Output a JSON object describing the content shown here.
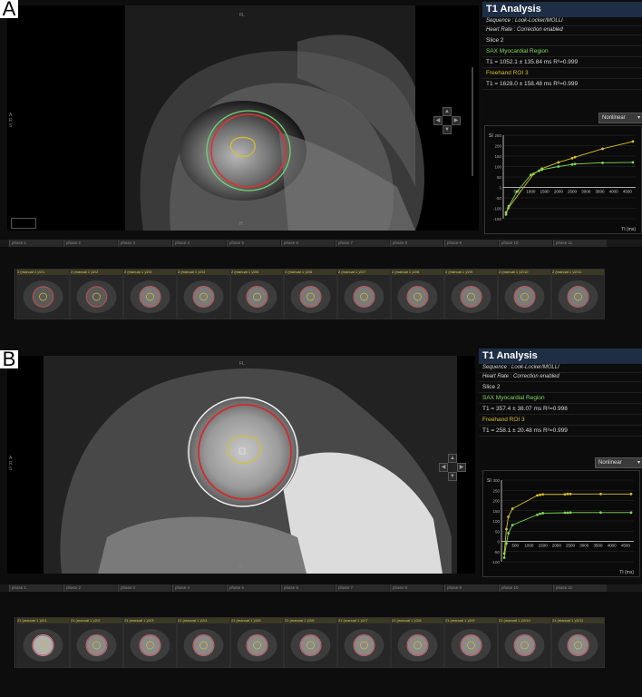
{
  "panels": [
    {
      "letter": "A",
      "t1": {
        "title": "T1 Analysis",
        "sequence": "Sequence : Look-Locker/MOLLI",
        "heart_rate": "Heart Rate : Correction enabled",
        "slice": "Slice 2",
        "region1_name": "SAX Myocardial Region",
        "region1_value": "T1 = 1052.1 ± 135.84 ms R²=0.999",
        "region2_name": "Freehand ROI 3",
        "region2_value": "T1 = 1628.0 ± 158.48 ms R²=0.999"
      },
      "fit_mode": "Nonlinear",
      "viewer_labels": {
        "top": "FL",
        "bottom": "H",
        "left": "A R S"
      },
      "phases": [
        "phase 1",
        "phase 2",
        "phase 3",
        "phase 4",
        "phase 5",
        "phase 6",
        "phase 7",
        "phase 8",
        "phase 9",
        "phase 10",
        "phase 11"
      ],
      "thumbnails": [
        "2 (manual 1 )/2/1",
        "2 (manual 1 )/2/2",
        "2 (manual 1 )/2/3",
        "2 (manual 1 )/2/4",
        "2 (manual 1 )/2/5",
        "2 (manual 1 )/2/6",
        "2 (manual 1 )/2/7",
        "2 (manual 1 )/2/8",
        "2 (manual 1 )/2/9",
        "2 (manual 1 )/2/10",
        "2 (manual 1 )/2/11"
      ],
      "chart_data": {
        "type": "scatter",
        "ylabel": "SI",
        "xlabel": "TI (ms)",
        "xlim": [
          0,
          4800
        ],
        "ylim": [
          -150,
          250
        ],
        "xticks": [
          500,
          1000,
          1500,
          2000,
          2500,
          3000,
          3500,
          4000,
          4500
        ],
        "yticks": [
          -150,
          -100,
          -50,
          0,
          50,
          100,
          150,
          200,
          250
        ],
        "series": [
          {
            "color": "#d7bf2a",
            "x": [
              100,
              180,
              1100,
              1300,
              1400,
              2000,
              2500,
              2600,
              3600,
              4700
            ],
            "y": [
              -120,
              -100,
              65,
              80,
              90,
              120,
              140,
              145,
              185,
              220
            ]
          },
          {
            "color": "#7ed957",
            "x": [
              100,
              200,
              500,
              1000,
              1300,
              1400,
              2000,
              2500,
              2600,
              3600,
              4700
            ],
            "y": [
              -130,
              -90,
              -20,
              60,
              80,
              85,
              100,
              110,
              112,
              118,
              120
            ]
          }
        ]
      }
    },
    {
      "letter": "B",
      "t1": {
        "title": "T1 Analysis",
        "sequence": "Sequence : Look-Locker/MOLLI",
        "heart_rate": "Heart Rate : Correction enabled",
        "slice": "Slice 2",
        "region1_name": "SAX Myocardial Region",
        "region1_value": "T1 = 357.4 ± 38.07 ms R²=0.998",
        "region2_name": "Freehand ROI 3",
        "region2_value": "T1 = 258.1 ± 20.48 ms R²=0.999"
      },
      "fit_mode": "Nonlinear",
      "viewer_labels": {
        "top": "FL",
        "bottom": "H",
        "left": "A R S"
      },
      "phases": [
        "phase 1",
        "phase 2",
        "phase 3",
        "phase 4",
        "phase 5",
        "phase 6",
        "phase 7",
        "phase 8",
        "phase 9",
        "phase 10",
        "phase 11"
      ],
      "thumbnails": [
        "21 (manual 1 )/2/1",
        "21 (manual 1 )/2/2",
        "21 (manual 1 )/2/3",
        "21 (manual 1 )/2/4",
        "21 (manual 1 )/2/5",
        "21 (manual 1 )/2/6",
        "21 (manual 1 )/2/7",
        "21 (manual 1 )/2/8",
        "21 (manual 1 )/2/9",
        "21 (manual 1 )/2/10",
        "21 (manual 1 )/2/11"
      ],
      "chart_data": {
        "type": "scatter",
        "ylabel": "SI",
        "xlabel": "TI (ms)",
        "xlim": [
          0,
          4800
        ],
        "ylim": [
          -100,
          300
        ],
        "xticks": [
          500,
          1000,
          1500,
          2000,
          2500,
          3000,
          3500,
          4000,
          4500
        ],
        "yticks": [
          -100,
          -50,
          0,
          50,
          100,
          150,
          200,
          250,
          300
        ],
        "series": [
          {
            "color": "#d7bf2a",
            "x": [
              100,
              180,
              250,
              400,
              1300,
              1400,
              1500,
              2300,
              2400,
              2500,
              3600,
              4700
            ],
            "y": [
              -60,
              60,
              120,
              160,
              225,
              228,
              230,
              230,
              232,
              232,
              232,
              232
            ]
          },
          {
            "color": "#7ed957",
            "x": [
              100,
              180,
              250,
              400,
              1300,
              1400,
              1500,
              2300,
              2400,
              2500,
              3600,
              4700
            ],
            "y": [
              -80,
              -10,
              40,
              80,
              130,
              135,
              138,
              140,
              140,
              141,
              141,
              141
            ]
          }
        ]
      }
    }
  ]
}
